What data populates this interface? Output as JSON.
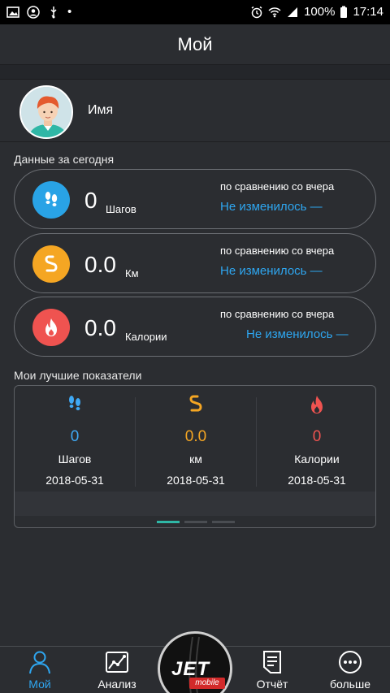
{
  "status_bar": {
    "battery": "100%",
    "time": "17:14",
    "dot": "•"
  },
  "header": {
    "title": "Мой"
  },
  "profile": {
    "name": "Имя"
  },
  "today": {
    "title": "Данные за сегодня",
    "cards": [
      {
        "value": "0",
        "unit": "Шагов",
        "compare": "по сравнению со вчера",
        "status": "Не изменилось —",
        "icon": "footsteps-icon",
        "color": "#29a3e6"
      },
      {
        "value": "0.0",
        "unit": "Км",
        "compare": "по сравнению со вчера",
        "status": "Не изменилось —",
        "icon": "route-icon",
        "color": "#f5a623"
      },
      {
        "value": "0.0",
        "unit": "Калории",
        "compare": "по сравнению со вчера",
        "status": "Не изменилось —",
        "icon": "flame-icon",
        "color": "#ef5350"
      }
    ]
  },
  "best": {
    "title": "Мои лучшие показатели",
    "items": [
      {
        "value": "0",
        "label": "Шагов",
        "date": "2018-05-31",
        "color": "#3fa9f5",
        "icon": "footsteps-icon"
      },
      {
        "value": "0.0",
        "label": "км",
        "date": "2018-05-31",
        "color": "#f5a623",
        "icon": "route-icon"
      },
      {
        "value": "0",
        "label": "Калории",
        "date": "2018-05-31",
        "color": "#ef5350",
        "icon": "flame-icon"
      }
    ]
  },
  "nav": {
    "items": [
      {
        "label": "Мой",
        "active": true
      },
      {
        "label": "Анализ"
      },
      {
        "label": "Отчёт"
      },
      {
        "label": "больше"
      }
    ],
    "center_logo": "JET",
    "center_logo_sub": "mobile"
  },
  "colors": {
    "accent": "#2ea6f0",
    "background": "#2b2d31"
  }
}
